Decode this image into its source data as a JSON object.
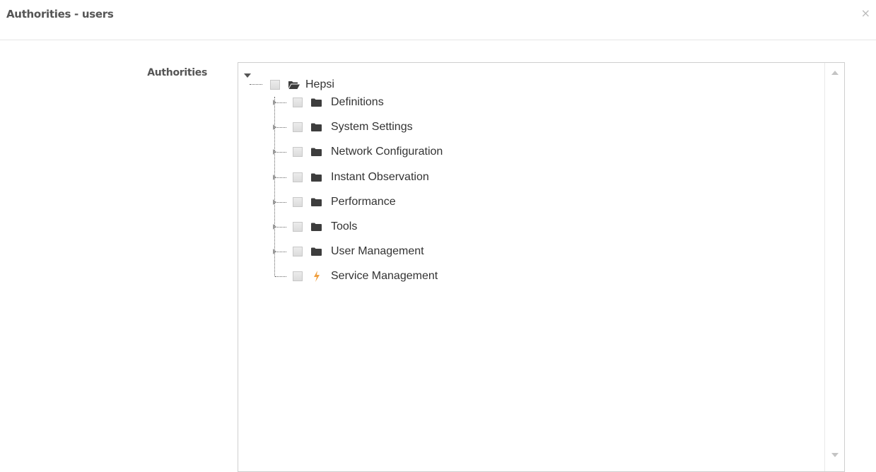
{
  "modal": {
    "title": "Authorities - users",
    "close_label": "×"
  },
  "form": {
    "authorities_label": "Authorities"
  },
  "tree": {
    "root": {
      "label": "Hepsi",
      "icon": "folder-open-icon",
      "checked": false,
      "expanded": true
    },
    "children": [
      {
        "label": "Definitions",
        "icon": "folder-icon",
        "checked": false,
        "expandable": true
      },
      {
        "label": "System Settings",
        "icon": "folder-icon",
        "checked": false,
        "expandable": true
      },
      {
        "label": "Network Configuration",
        "icon": "folder-icon",
        "checked": false,
        "expandable": true
      },
      {
        "label": "Instant Observation",
        "icon": "folder-icon",
        "checked": false,
        "expandable": true
      },
      {
        "label": "Performance",
        "icon": "folder-icon",
        "checked": false,
        "expandable": true
      },
      {
        "label": "Tools",
        "icon": "folder-icon",
        "checked": false,
        "expandable": true
      },
      {
        "label": "User Management",
        "icon": "folder-icon",
        "checked": false,
        "expandable": true
      },
      {
        "label": "Service Management",
        "icon": "bolt-icon",
        "checked": false,
        "expandable": false
      }
    ]
  },
  "colors": {
    "folder": "#3d3d3d",
    "bolt": "#f0a040",
    "title": "#555555"
  }
}
